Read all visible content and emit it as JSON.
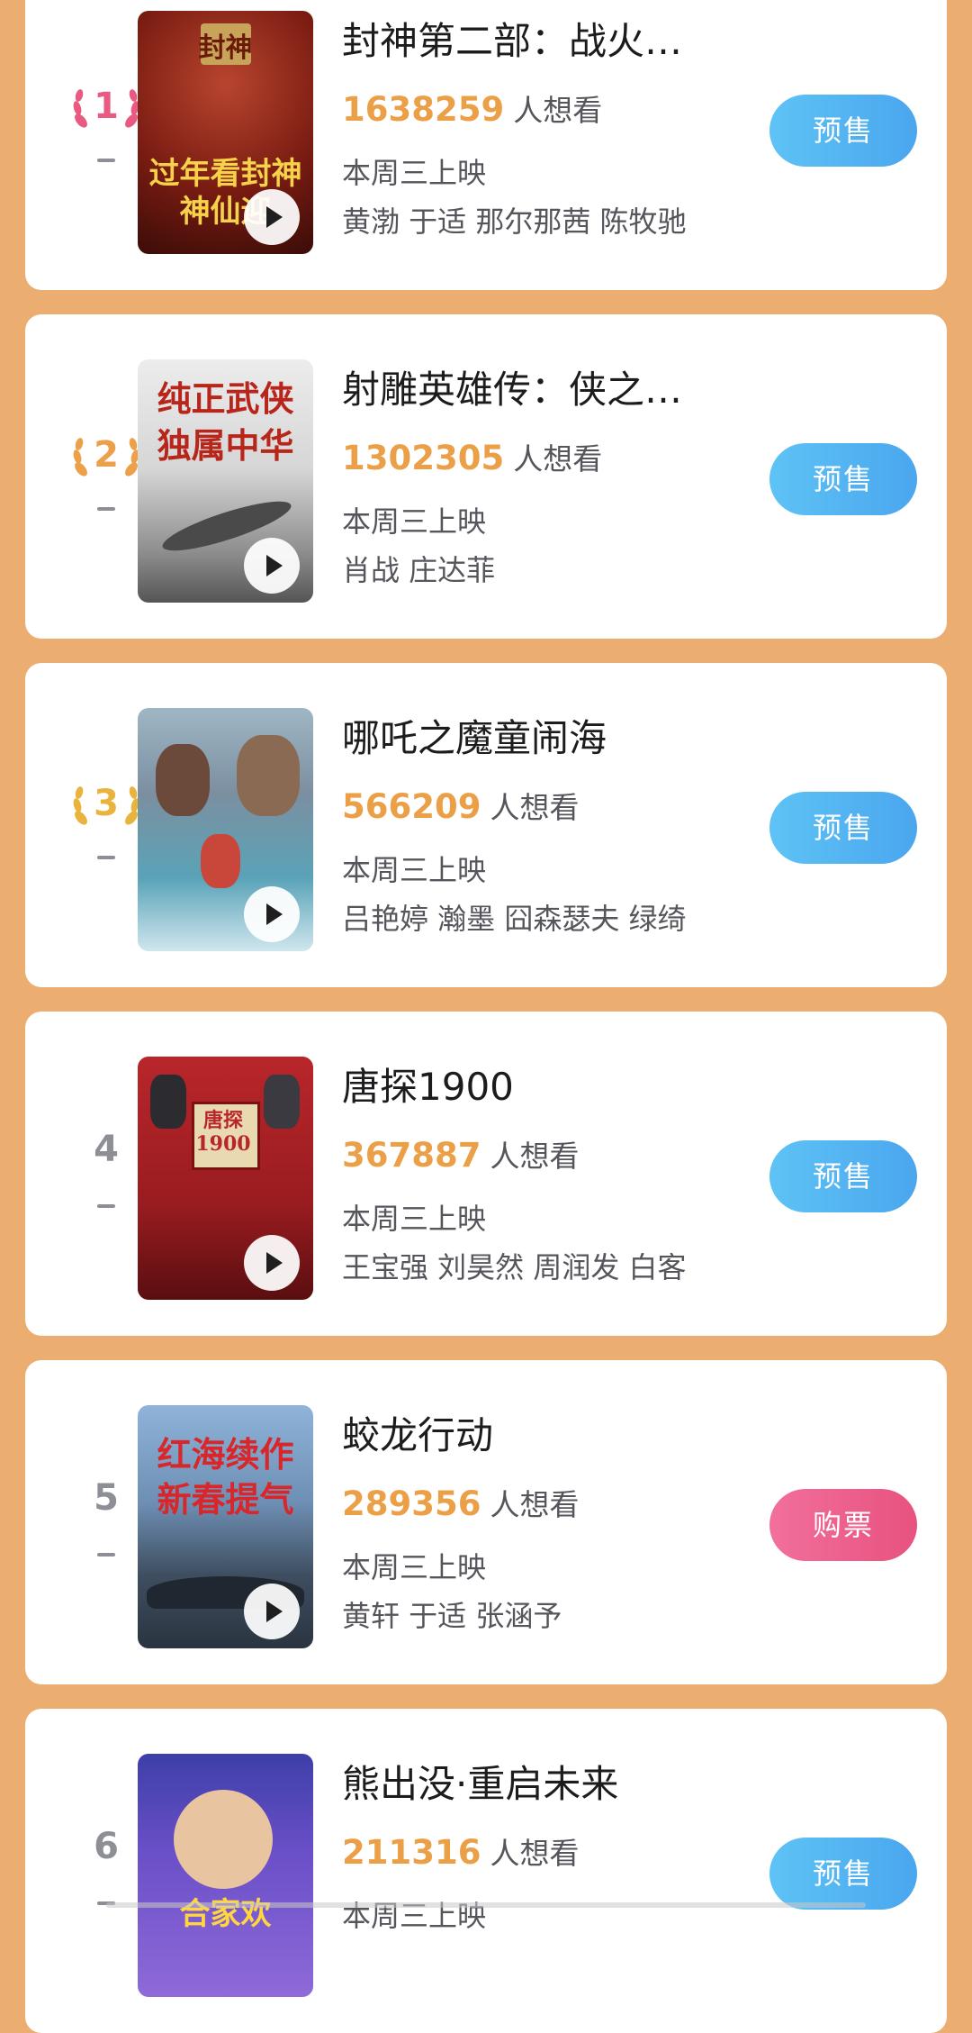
{
  "colors": {
    "page_background": "#EBAE70",
    "want_count": "#EBA048",
    "presale_button": "#4AA6EE",
    "buy_button": "#E8527F",
    "rank1_laurel": "#E85A82",
    "rank2_laurel": "#EDA04A",
    "rank3_laurel": "#E9B43E"
  },
  "want_suffix": "人想看",
  "movies": [
    {
      "rank": "1",
      "title": "封神第二部：战火…",
      "want_count": "1638259",
      "release": "本周三上映",
      "cast": "黄渤 于适 那尔那茜 陈牧驰",
      "button": "预售",
      "poster_top": "封神",
      "poster_lines": "过年看封神 神仙迎"
    },
    {
      "rank": "2",
      "title": "射雕英雄传：侠之…",
      "want_count": "1302305",
      "release": "本周三上映",
      "cast": "肖战 庄达菲",
      "button": "预售",
      "poster_lines": "纯正武侠 独属中华"
    },
    {
      "rank": "3",
      "title": "哪吒之魔童闹海",
      "want_count": "566209",
      "release": "本周三上映",
      "cast": "吕艳婷 瀚墨 囧森瑟夫 绿绮",
      "button": "预售"
    },
    {
      "rank": "4",
      "title": "唐探1900",
      "want_count": "367887",
      "release": "本周三上映",
      "cast": "王宝强 刘昊然 周润发 白客",
      "button": "预售",
      "poster_lines": "唐探 1900"
    },
    {
      "rank": "5",
      "title": "蛟龙行动",
      "want_count": "289356",
      "release": "本周三上映",
      "cast": "黄轩 于适 张涵予",
      "button": "购票",
      "poster_lines": "红海续作 新春提气"
    },
    {
      "rank": "6",
      "title": "熊出没·重启未来",
      "want_count": "211316",
      "release": "本周三上映",
      "cast": "",
      "button": "预售",
      "poster_lines": "合家欢"
    }
  ]
}
